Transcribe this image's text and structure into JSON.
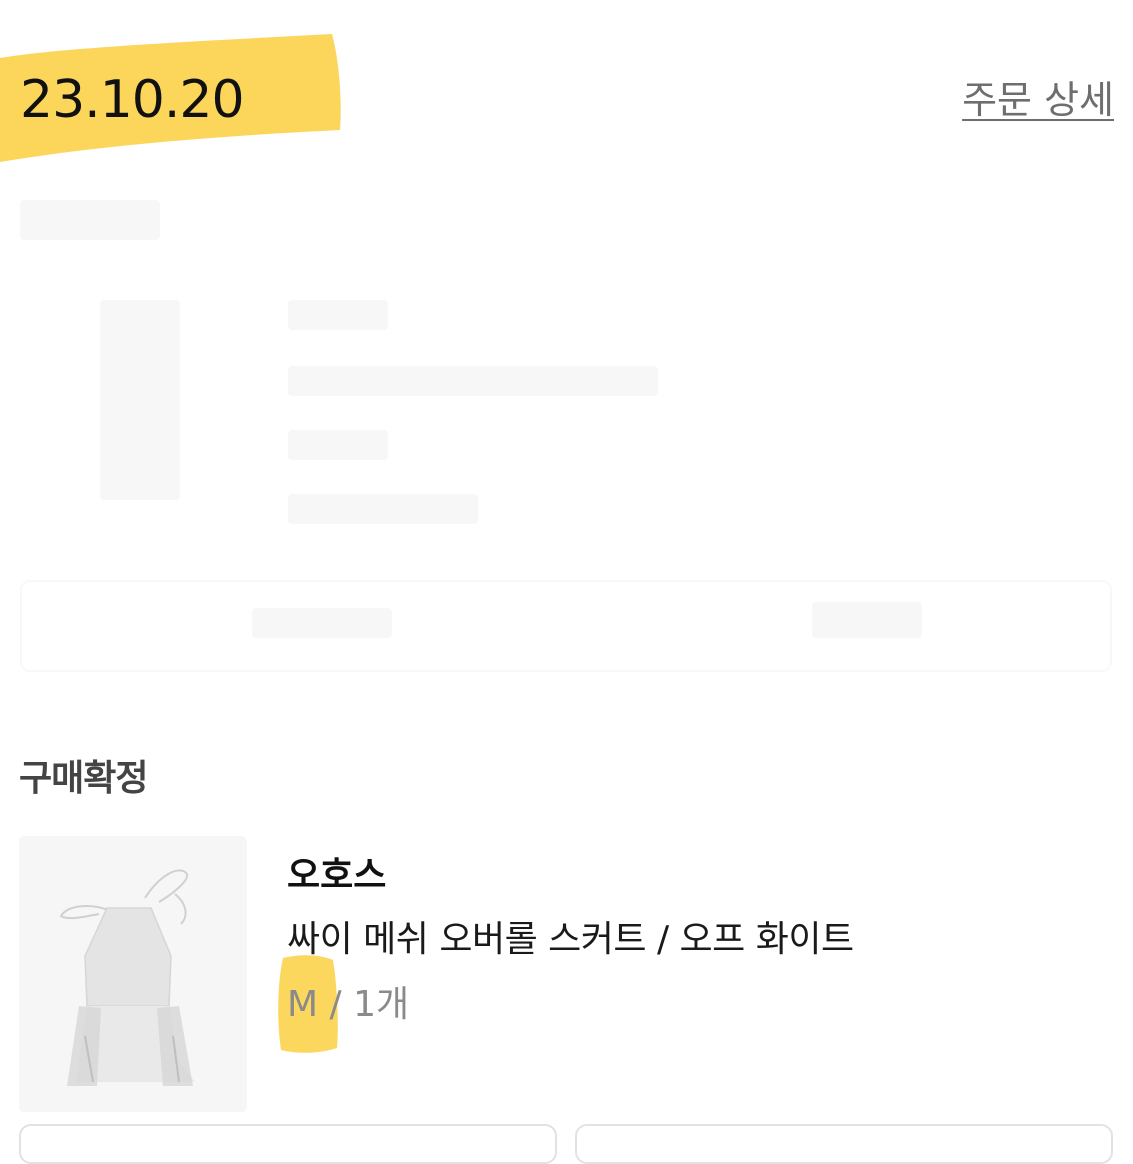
{
  "order": {
    "date": "23.10.20",
    "detail_link": "주문 상세"
  },
  "status": {
    "label": "구매확정"
  },
  "product": {
    "brand": "오호스",
    "name": "싸이 메쉬 오버롤 스커트 / 오프 화이트",
    "option_size": "M",
    "option_separator": " / ",
    "option_quantity": "1개"
  },
  "colors": {
    "highlight": "#fbd34d",
    "link": "#6e6e6e",
    "muted_text": "#8a8a8a"
  }
}
